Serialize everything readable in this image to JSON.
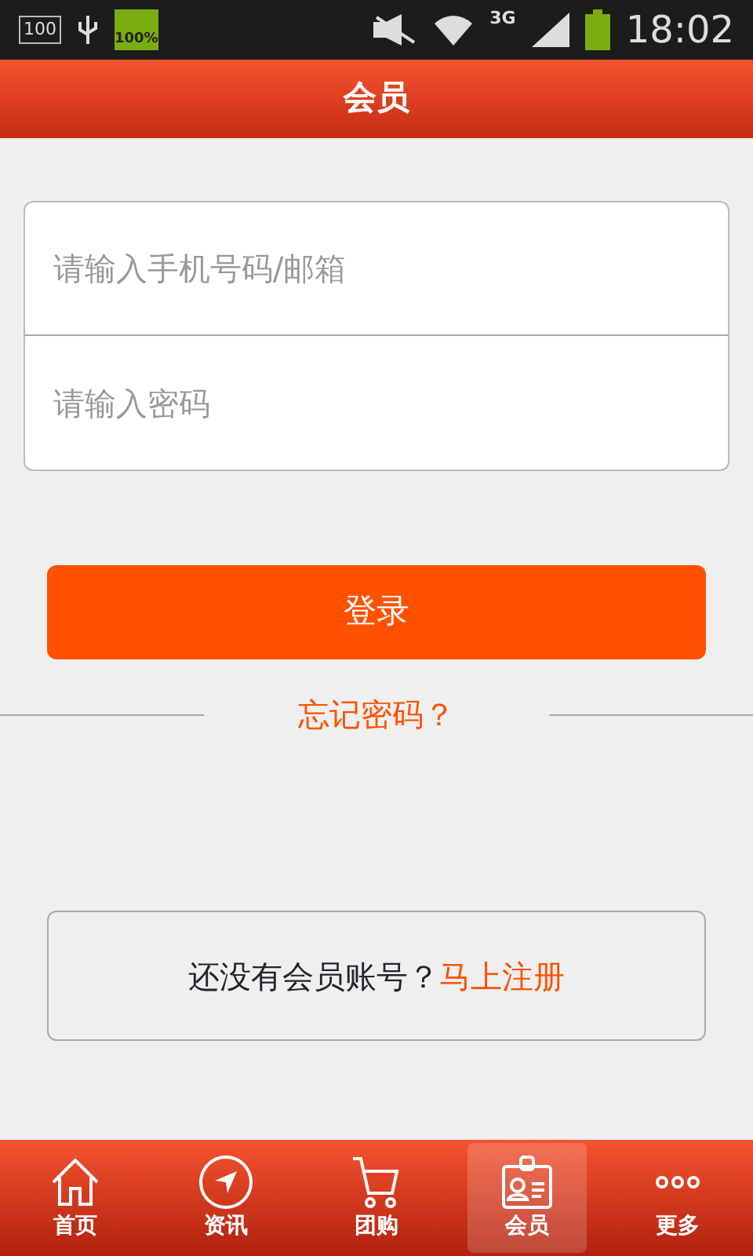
{
  "status_bar": {
    "left_badge": "100",
    "battery_label": "100%",
    "network": "3G",
    "time": "18:02"
  },
  "header": {
    "title": "会员"
  },
  "login_form": {
    "fields": [
      {
        "placeholder": "请输入手机号码/邮箱"
      },
      {
        "placeholder": "请输入密码"
      }
    ],
    "submit": "登录",
    "forgot": "忘记密码？"
  },
  "register": {
    "text": "还没有会员账号？",
    "link": "马上注册"
  },
  "tabs": [
    {
      "label": "首页",
      "selected": false
    },
    {
      "label": "资讯",
      "selected": false
    },
    {
      "label": "团购",
      "selected": false
    },
    {
      "label": "会员",
      "selected": true
    },
    {
      "label": "更多",
      "selected": false
    }
  ]
}
